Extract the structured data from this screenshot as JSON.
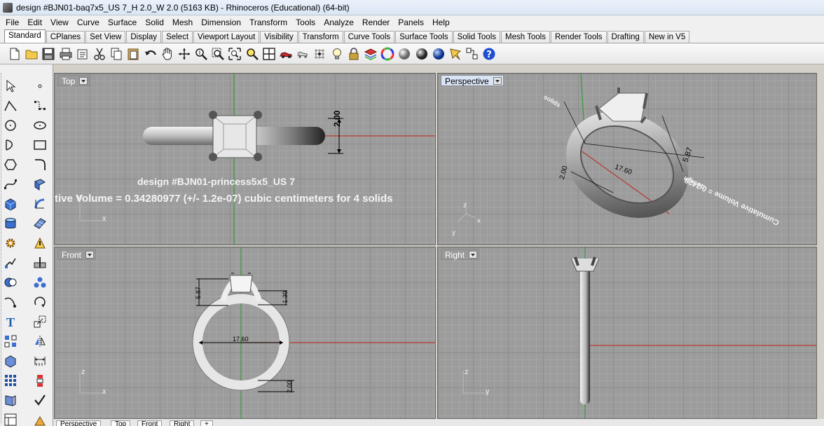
{
  "window": {
    "title": "design #BJN01-baq7x5_US 7_H 2.0_W 2.0 (5163 KB) - Rhinoceros (Educational) (64-bit)"
  },
  "menu": [
    "File",
    "Edit",
    "View",
    "Curve",
    "Surface",
    "Solid",
    "Mesh",
    "Dimension",
    "Transform",
    "Tools",
    "Analyze",
    "Render",
    "Panels",
    "Help"
  ],
  "tabs": [
    "Standard",
    "CPlanes",
    "Set View",
    "Display",
    "Select",
    "Viewport Layout",
    "Visibility",
    "Transform",
    "Curve Tools",
    "Surface Tools",
    "Solid Tools",
    "Mesh Tools",
    "Render Tools",
    "Drafting",
    "New in V5"
  ],
  "active_tab": "Standard",
  "toolbar_icons": [
    "new-document-icon",
    "open-folder-icon",
    "save-icon",
    "print-icon",
    "import-icon",
    "cut-icon",
    "copy-icon",
    "paste-icon",
    "undo-icon",
    "pan-hand-icon",
    "rotate-view-icon",
    "zoom-dynamic-icon",
    "zoom-window-icon",
    "zoom-extents-icon",
    "zoom-selected-icon",
    "four-viewports-icon",
    "car-icon",
    "display-options-icon",
    "grid-snap-icon",
    "lightbulb-icon",
    "lock-icon",
    "layer-icon",
    "color-wheel-icon",
    "wireframe-sphere-icon",
    "shaded-sphere-icon",
    "rendered-sphere-icon",
    "gumball-icon",
    "options-icon",
    "help-icon"
  ],
  "viewports": {
    "top": {
      "label": "Top",
      "text_line1": "design #BJN01-princess5x5_US 7",
      "text_line2": "tive Volume = 0.34280977 (+/- 1.2e-07) cubic centimeters for 4 solids",
      "dim_label": "2.00",
      "axis_x": "x",
      "axis_y": "y"
    },
    "perspective": {
      "label": "Perspective",
      "dim_label_a": "5.87",
      "dim_label_b": "17.60",
      "dim_label_c": "2.00",
      "overlay_text": "Cumulative Volume = 0.3428",
      "overlay_text2": "design",
      "overlay_text3": "solids",
      "axis_x": "x",
      "axis_y": "y",
      "axis_z": "z"
    },
    "front": {
      "label": "Front",
      "dim_label_height": "5.87",
      "dim_label_top": "1.30",
      "dim_label_width": "17.60",
      "dim_label_bottom": "2.00",
      "axis_x": "x",
      "axis_z": "z"
    },
    "right": {
      "label": "Right",
      "axis_y": "y",
      "axis_z": "z"
    }
  },
  "bottom_tabs": [
    "Perspective",
    "Top",
    "Front",
    "Right",
    "+"
  ],
  "colors": {
    "grid_bg": "#9c9c9c",
    "x_axis": "#b53a2e",
    "y_axis": "#3a9a3a",
    "active_label": "#d9e4f6"
  }
}
